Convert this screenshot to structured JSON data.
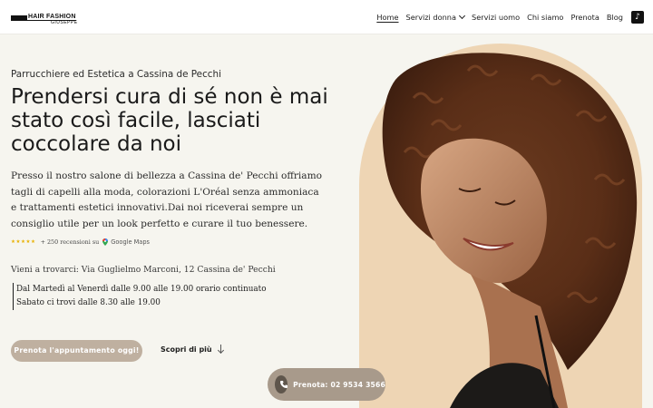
{
  "logo": {
    "line1": "HAIR FASHION",
    "line2": "GIUSEPPE"
  },
  "nav": {
    "items": [
      {
        "label": "Home"
      },
      {
        "label": "Servizi donna"
      },
      {
        "label": "Servizi uomo"
      },
      {
        "label": "Chi siamo"
      },
      {
        "label": "Prenota"
      },
      {
        "label": "Blog"
      }
    ],
    "tiktok_icon": "tiktok-icon"
  },
  "hero": {
    "subtitle": "Parrucchiere ed Estetica a Cassina de Pecchi",
    "headline": "Prendersi cura di sé non è mai stato così facile, lasciati coccolare da noi",
    "description": "Presso il nostro salone di bellezza a Cassina de' Pecchi offriamo tagli di capelli alla moda, colorazioni L'Oréal senza ammoniaca e trattamenti estetici innovativi.Dai noi riceverai sempre un consiglio utile per un look perfetto e curare il tuo benessere.",
    "reviews": {
      "stars": "★★★★★",
      "rating": 5,
      "count_text": "+ 250 recensioni su",
      "source": "Google Maps"
    },
    "address": "Vieni a trovarci: Via Guglielmo Marconi, 12 Cassina de' Pecchi",
    "hours": [
      "Dal Martedì al Venerdì dalle 9.00 alle 19.00 orario continuato",
      "Sabato ci trovi dalle 8.30 alle 19.00"
    ],
    "cta_label": "Prenota l'appuntamento oggi!",
    "more_label": "Scopri di più"
  },
  "call": {
    "label": "Prenota: 02 9534 3566"
  },
  "colors": {
    "background": "#f6f5ef",
    "arch": "#eed5b4",
    "cta": "#bfb0a0",
    "call_button": "#a89a8b",
    "stars": "#e8b100"
  }
}
